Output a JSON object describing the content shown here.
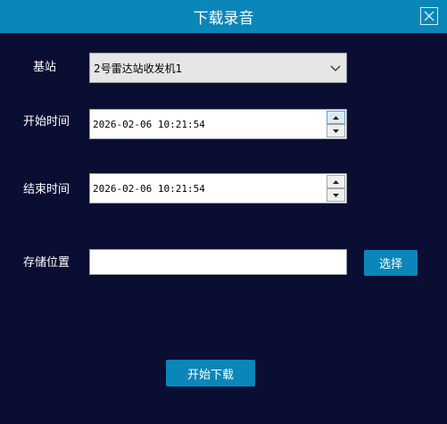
{
  "window": {
    "title": "下载录音"
  },
  "form": {
    "station_label": "基站",
    "station_value": "2号雷达站收发机1",
    "start_label": "开始时间",
    "start_value": "2026-02-06 10:21:54",
    "end_label": "结束时间",
    "end_value": "2026-02-06 10:21:54",
    "storage_label": "存储位置",
    "storage_value": "",
    "browse_label": "选择"
  },
  "footer": {
    "download_label": "开始下载"
  },
  "colors": {
    "background": "#0b0e33",
    "accent": "#0a86b8"
  }
}
